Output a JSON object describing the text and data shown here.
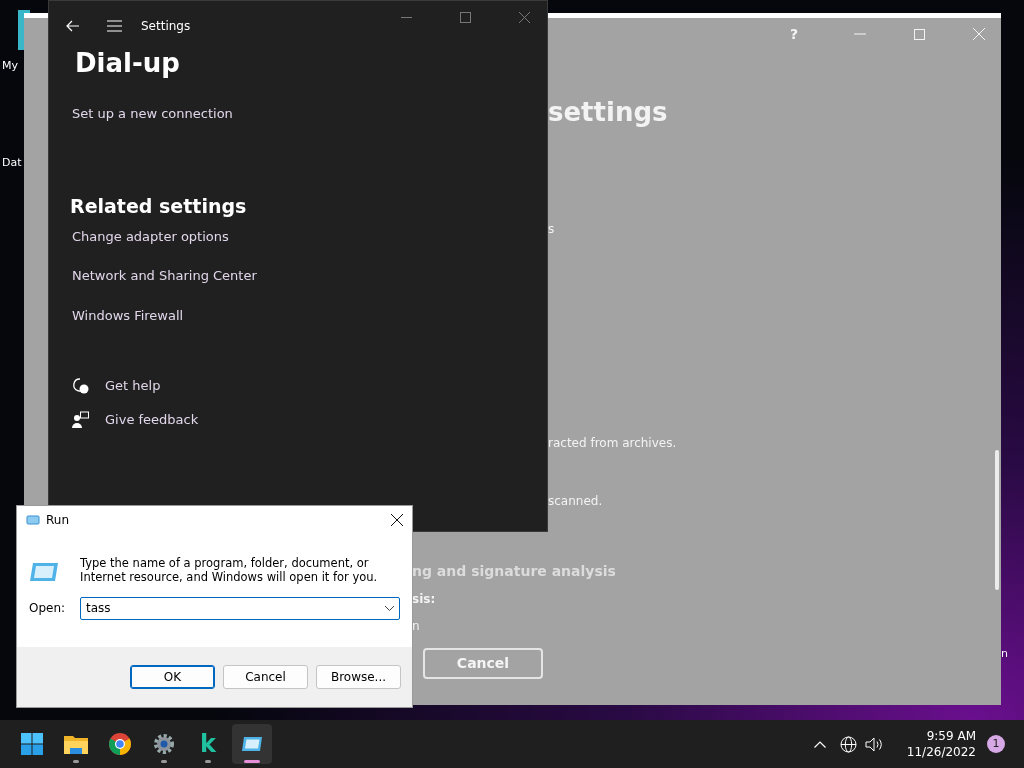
{
  "desktop_icons": [
    {
      "label": "My"
    },
    {
      "label": "Dat"
    }
  ],
  "background_window": {
    "upper_texts": [
      {
        "kind": "heading",
        "text": "settings"
      },
      {
        "kind": "plain",
        "text": "s"
      },
      {
        "kind": "plain",
        "text": "racted from archives."
      },
      {
        "kind": "plain",
        "text": "scanned."
      }
    ],
    "lower_texts": [
      {
        "kind": "subheading",
        "text": "ng and signature analysis"
      },
      {
        "kind": "label",
        "text": "sis:"
      },
      {
        "kind": "plain",
        "text": "n"
      }
    ],
    "cancel_button": "Cancel",
    "help_button": "?"
  },
  "desktop_edge_text": "n",
  "settings_window": {
    "title": "Settings",
    "page_title": "Dial-up",
    "primary_link": "Set up a new connection",
    "related_heading": "Related settings",
    "related_links": [
      "Change adapter options",
      "Network and Sharing Center",
      "Windows Firewall"
    ],
    "help_links": [
      {
        "kind": "help",
        "label": "Get help"
      },
      {
        "kind": "feedback",
        "label": "Give feedback"
      }
    ]
  },
  "run_dialog": {
    "title": "Run",
    "description": "Type the name of a program, folder, document, or Internet resource, and Windows will open it for you.",
    "open_label": "Open:",
    "open_value": "tass",
    "buttons": [
      {
        "label": "OK",
        "default": true
      },
      {
        "label": "Cancel",
        "default": false
      },
      {
        "label": "Browse...",
        "default": false
      }
    ]
  },
  "taskbar": {
    "apps": [
      {
        "kind": "start",
        "running": false,
        "selected": false
      },
      {
        "kind": "explorer",
        "running": true,
        "selected": false
      },
      {
        "kind": "chrome",
        "running": false,
        "selected": false
      },
      {
        "kind": "settings",
        "running": true,
        "selected": false
      },
      {
        "kind": "letter",
        "label": "k",
        "running": true,
        "selected": false
      },
      {
        "kind": "run",
        "running": true,
        "selected": true
      }
    ],
    "time": "9:59 AM",
    "date": "11/26/2022",
    "notification_count": "1"
  }
}
